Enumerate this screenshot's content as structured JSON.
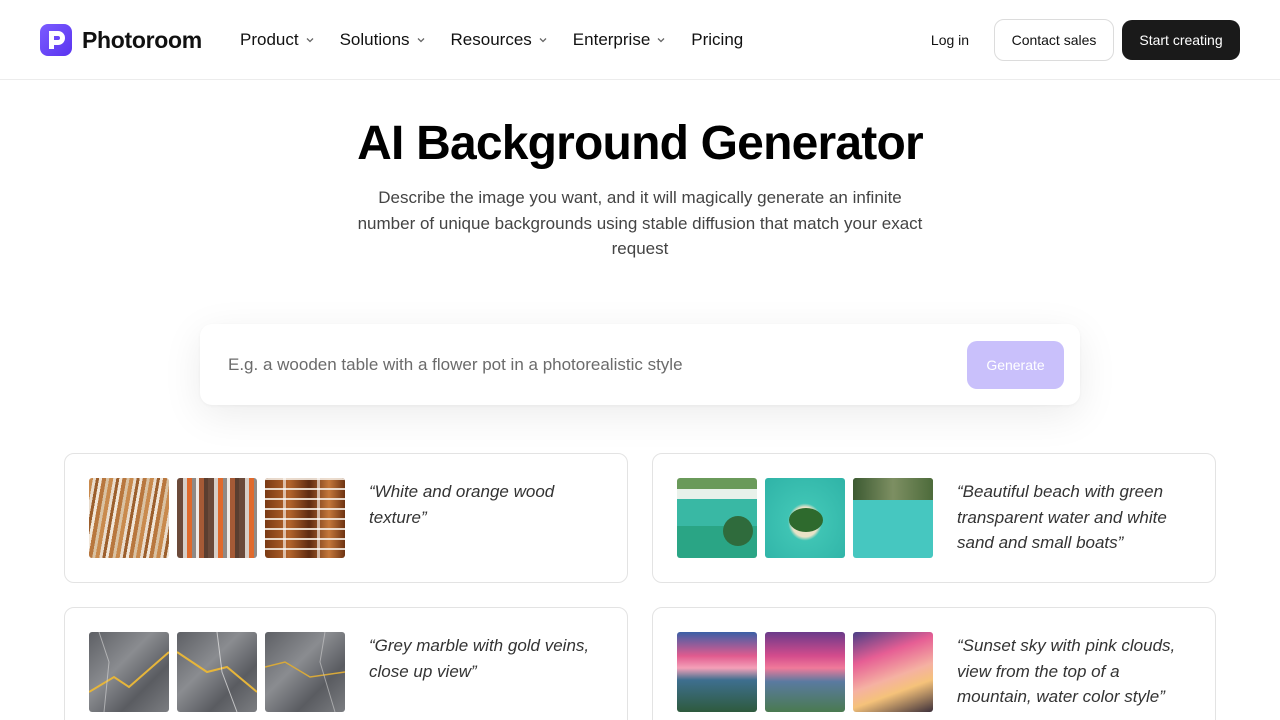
{
  "header": {
    "brand": "Photoroom",
    "nav": [
      {
        "label": "Product",
        "has_dropdown": true
      },
      {
        "label": "Solutions",
        "has_dropdown": true
      },
      {
        "label": "Resources",
        "has_dropdown": true
      },
      {
        "label": "Enterprise",
        "has_dropdown": true
      },
      {
        "label": "Pricing",
        "has_dropdown": false
      }
    ],
    "login_label": "Log in",
    "contact_label": "Contact sales",
    "start_label": "Start creating"
  },
  "hero": {
    "title": "AI Background Generator",
    "subtitle": "Describe the image you want, and it will magically generate an infinite number of unique backgrounds using stable diffusion that match your exact request"
  },
  "prompt": {
    "placeholder": "E.g. a wooden table with a flower pot in a photorealistic style",
    "value": "",
    "button_label": "Generate"
  },
  "examples": [
    {
      "quote": "“White and orange wood texture”",
      "thumbnails": [
        "wood-texture-1",
        "wood-texture-2",
        "wood-texture-3"
      ]
    },
    {
      "quote": "“Beautiful beach with green transparent water and white sand and small boats”",
      "thumbnails": [
        "beach-1",
        "beach-2",
        "beach-3"
      ]
    },
    {
      "quote": "“Grey marble with gold veins, close up view”",
      "thumbnails": [
        "marble-1",
        "marble-2",
        "marble-3"
      ]
    },
    {
      "quote": "“Sunset sky with pink clouds, view from the top of a mountain, water color style”",
      "thumbnails": [
        "sunset-1",
        "sunset-2",
        "sunset-3"
      ]
    }
  ],
  "colors": {
    "brand": "#6b46f5",
    "primary_button": "#1a1a1a",
    "generate_button": "#c9c0fb"
  }
}
